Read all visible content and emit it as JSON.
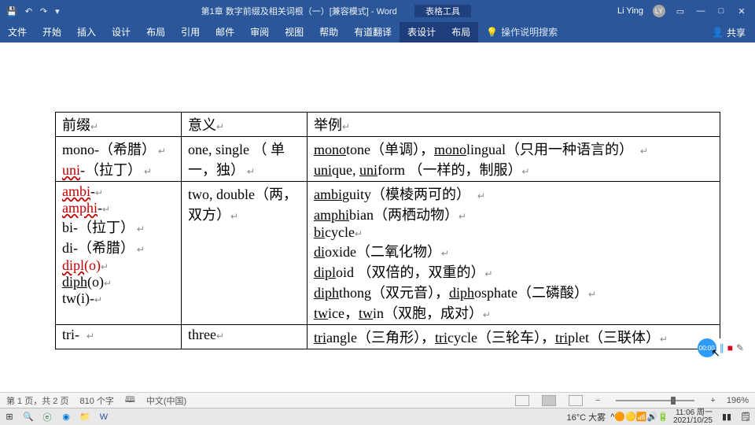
{
  "title": "第1章 数字前缀及相关词根（一）[兼容模式] - Word",
  "tabletools": "表格工具",
  "user": "Li Ying",
  "avatar": "LY",
  "ribbon": {
    "file": "文件",
    "home": "开始",
    "insert": "插入",
    "design": "设计",
    "layout": "布局",
    "ref": "引用",
    "mail": "邮件",
    "review": "审阅",
    "view": "视图",
    "help": "帮助",
    "youdao": "有道翻译",
    "tdesign": "表设计",
    "tlayout": "布局",
    "tellme": "操作说明搜索",
    "share": "共享"
  },
  "status": {
    "page": "第 1 页，共 2 页",
    "words": "810 个字",
    "lang": "中文(中国)",
    "zoom": "196%"
  },
  "table": {
    "h1": "前缀",
    "h2": "意义",
    "h3": "举例",
    "r1c1a_pre": "mono-",
    "r1c1a_par": "（希腊）",
    "r1c1b_pre": "uni",
    "r1c1b_par": "-（拉丁）",
    "r1c2": "one,  single （ 单一，独）",
    "r1c3_mono": "mono",
    "r1c3_a": "tone（单调），",
    "r1c3_mono2": "mono",
    "r1c3_b": "lingual（只用一种语言的）",
    "r1c3_uni": "uni",
    "r1c3_c": "que, ",
    "r1c3_uni2": "uni",
    "r1c3_d": "form  （一样的，制服）",
    "r2": {
      "ambi": "ambi",
      "amphi": "amphi",
      "bi": "bi-（拉丁）",
      "di": "di-（希腊）",
      "dipl": "dipl",
      "diplo": "(o)",
      "diph": "diph",
      "dipho": "(o)",
      "twi": "tw(i)-",
      "meaning": "two,      double（两，双方）",
      "e_ambi": "ambi",
      "e_ambi2": "guity（模棱两可的）",
      "e_amphi": "amphi",
      "e_amphi2": "bian（两栖动物）",
      "e_bi": "bi",
      "e_bi2": "cycle",
      "e_di": "di",
      "e_di2": "oxide（二氧化物）",
      "e_dipl": "dipl",
      "e_dipl2": "oid  （双倍的，双重的）",
      "e_diph": "diph",
      "e_diph2": "thong（双元音），",
      "e_diph3": "diph",
      "e_diph4": "osphate（二磷酸）",
      "e_tw": "tw",
      "e_tw2": "ice，",
      "e_tw3": "tw",
      "e_tw4": "in（双胞，成对）"
    },
    "r3": {
      "tri": "tri-",
      "meaning": "three",
      "e_tri": "tri",
      "e_tri2": "angle（三角形），",
      "e_tri3": "tri",
      "e_tri4": "cycle（三轮车），",
      "e_tri5": "tri",
      "e_tri6": "plet（三联体）"
    }
  },
  "rec": "00:00",
  "taskbar": {
    "weather": "16°C 大雾",
    "time": "11:06 周一",
    "date": "2021/10/25"
  }
}
